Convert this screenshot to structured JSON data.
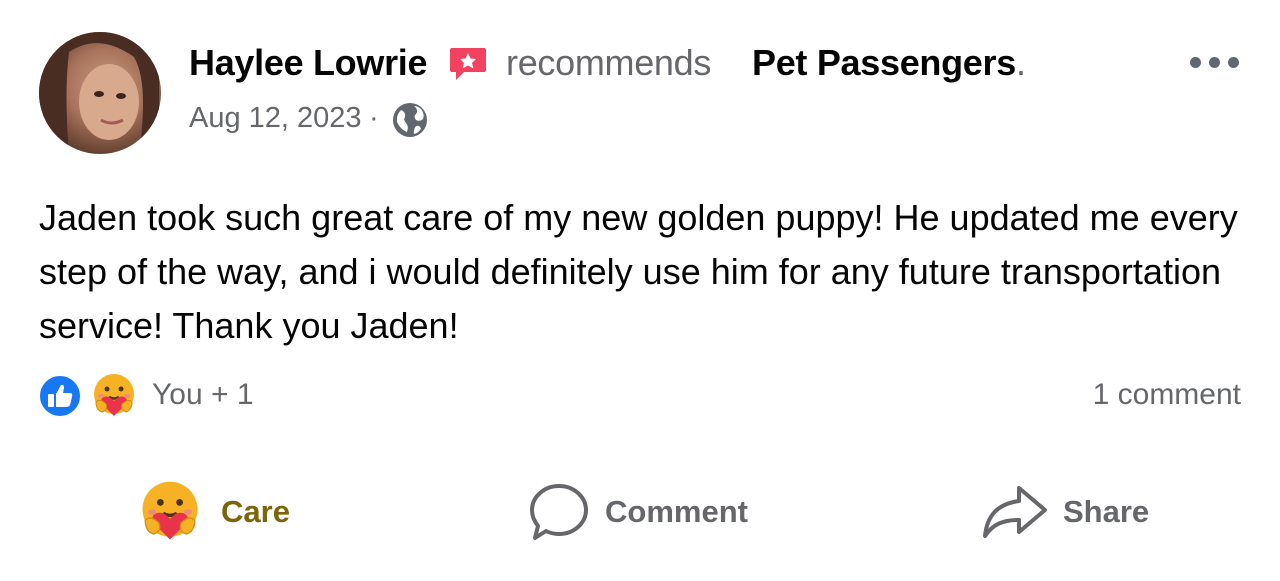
{
  "post": {
    "author": "Haylee Lowrie",
    "verb": "recommends",
    "page": "Pet Passengers",
    "page_suffix": ".",
    "date": "Aug 12, 2023",
    "separator": "·",
    "privacy_icon": "globe-icon",
    "text": "Jaden took such great care of my new golden puppy! He updated me every step of the way, and i would definitely use him for any future transportation service! Thank you Jaden!"
  },
  "reactions": {
    "icons": [
      "like-reaction-icon",
      "care-reaction-icon"
    ],
    "summary": "You + 1",
    "comments": "1 comment"
  },
  "actions": {
    "care_label": "Care",
    "comment_label": "Comment",
    "share_label": "Share"
  },
  "colors": {
    "primary_text": "#050505",
    "secondary_text": "#65676b",
    "like_blue": "#1877f2",
    "care_label": "#7c6408",
    "recommend_badge": "#f3425f"
  }
}
